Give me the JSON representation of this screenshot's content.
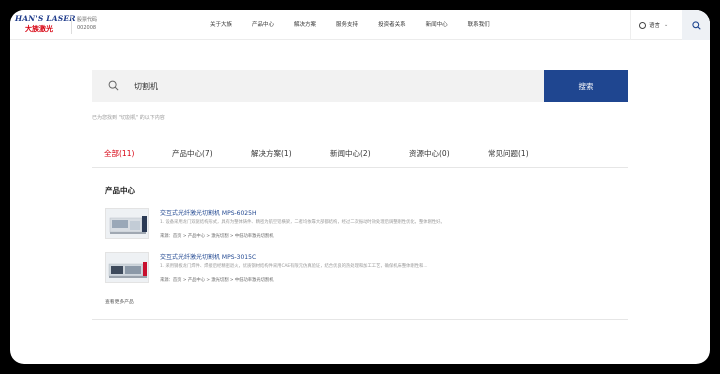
{
  "header": {
    "logo_text_top": "HAN'S LASER",
    "logo_text_bottom": "大族激光",
    "stock_label": "股票代码",
    "stock_code": "002008",
    "nav": [
      "关于大族",
      "产品中心",
      "解决方案",
      "服务支持",
      "投资者关系",
      "新闻中心",
      "联系我们"
    ],
    "language_label": "语言"
  },
  "search": {
    "query": "切割机",
    "button_label": "搜索",
    "result_hint": "已为您找到 \"切割机\" 的以下内容"
  },
  "tabs": [
    {
      "label": "全部(11)",
      "active": true
    },
    {
      "label": "产品中心(7)",
      "active": false
    },
    {
      "label": "解决方案(1)",
      "active": false
    },
    {
      "label": "新闻中心(2)",
      "active": false
    },
    {
      "label": "资源中心(0)",
      "active": false
    },
    {
      "label": "常见问题(1)",
      "active": false
    }
  ],
  "section_title": "产品中心",
  "products": [
    {
      "title": "交互式光纤激光切割机 MPS-6025H",
      "desc": "1. 设备采用龙门双驱结构形式，具有为整体铸件、精密为航空铝横梁，二者均依靠大部都结构，经过二次振动时效处理后调整刚性优化，整体刚性好。",
      "source": "来源：首页 > 产品中心 > 激光切割 > 中低功率激光切割机"
    },
    {
      "title": "交互式光纤激光切割机 MPS-3015C",
      "desc": "1. 采用钢板龙门焊件、焊接后经精密退火，优质钢材结构件采用CAE有限元仿真验证，结合优良的热处理和加工工艺，确保机床整体刚性和...",
      "source": "来源：首页 > 产品中心 > 激光切割 > 中低功率激光切割机"
    }
  ],
  "more_link": "查看更多产品",
  "colors": {
    "brand_blue": "#1f4690",
    "active_red": "#d7000f"
  }
}
